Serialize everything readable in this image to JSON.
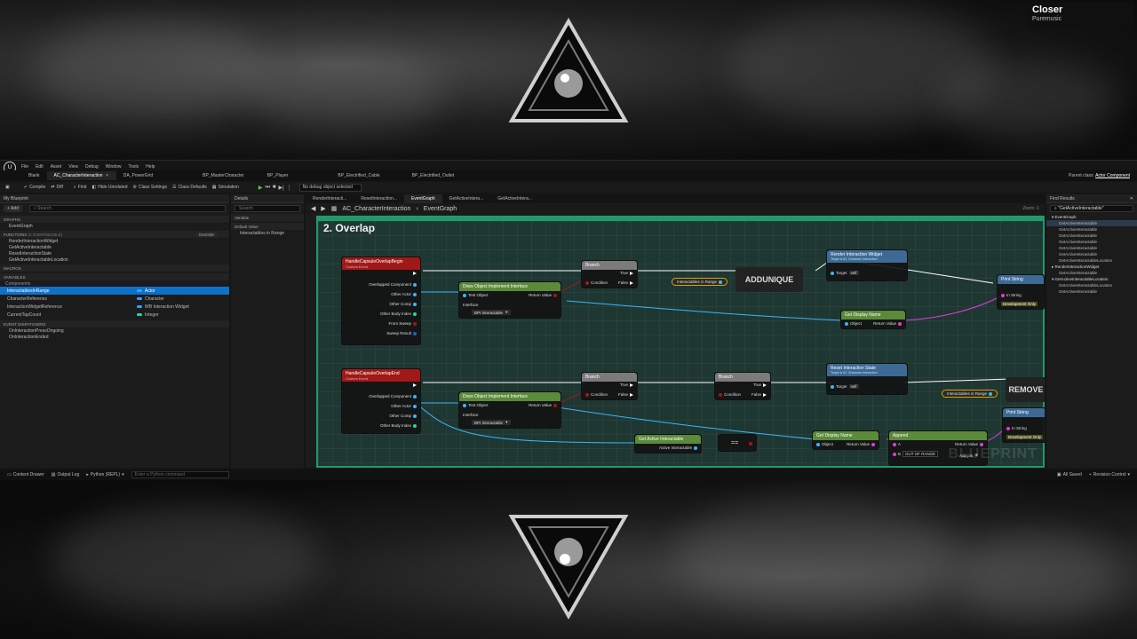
{
  "music": {
    "title": "Closer",
    "artist": "Puremusic"
  },
  "menu": [
    "File",
    "Edit",
    "Asset",
    "View",
    "Debug",
    "Window",
    "Tools",
    "Help"
  ],
  "doc_tabs": [
    {
      "label": "Blank"
    },
    {
      "label": "AC_CharacterInteraction",
      "active": true
    },
    {
      "label": "DA_PowerGrid"
    },
    {
      "label": "BP_MasterCharacter"
    },
    {
      "label": "BP_Player"
    },
    {
      "label": "BP_Electrified_Cable"
    },
    {
      "label": "BP_Electrified_Outlet"
    }
  ],
  "parent_class": {
    "label": "Parent class:",
    "value": "Actor Component"
  },
  "toolbar": {
    "compile": "Compile",
    "diff": "Diff",
    "find": "Find",
    "hide_unrelated": "Hide Unrelated",
    "class_settings": "Class Settings",
    "class_defaults": "Class Defaults",
    "simulation": "Simulation",
    "debug_select": "No debug object selected"
  },
  "my_blueprint": {
    "title": "My Blueprint",
    "add": "+ Add",
    "search_placeholder": "Search",
    "graphs_label": "GRAPHS",
    "graphs": [
      "EventGraph"
    ],
    "functions_label": "FUNCTIONS",
    "functions_count": "(2 OVERRIDABLE)",
    "override": "Override",
    "functions": [
      "RenderInteractionWidget",
      "GetActiveInteractable",
      "ResetInteractionState",
      "GetActiveInteractableLocation"
    ],
    "macros_label": "MACROS",
    "variables_label": "VARIABLES",
    "components_label": "Components",
    "variables": [
      {
        "name": "InteractablesInRange",
        "type": "Actor",
        "color": "#3aa0ff",
        "selected": true
      },
      {
        "name": "CharacterReference",
        "type": "Character",
        "color": "#3aa0ff"
      },
      {
        "name": "InteractionWidgetReference",
        "type": "WB Interaction Widget",
        "color": "#3aa0ff"
      },
      {
        "name": "CurrentTapCount",
        "type": "Integer",
        "color": "#1fd6b0"
      }
    ],
    "dispatchers_label": "EVENT DISPATCHERS",
    "dispatchers": [
      "OnInteractionPressOngoing",
      "OnInteractionEnded"
    ]
  },
  "details": {
    "title": "Details",
    "search_placeholder": "Search",
    "variable_label": "Variable",
    "default_value_label": "Default Value",
    "default_item": "Interactables in Range"
  },
  "graph": {
    "tabs": [
      "RenderInteracti...",
      "ResetInteraction...",
      "EventGraph",
      "GetActiveIntera...",
      "GetActiveIntera..."
    ],
    "breadcrumb_root": "AC_CharacterInteraction",
    "breadcrumb_leaf": "EventGraph",
    "zoom": "Zoom -1",
    "comment": "2. Overlap",
    "watermark": "BLUEPRINT",
    "nodes": {
      "begin_overlap": {
        "title": "HandleCapsuleOverlapBegin",
        "sub": "Custom Event",
        "pins": [
          "Overlapped Component",
          "Other Actor",
          "Other Comp",
          "Other Body Index",
          "From Sweep",
          "Sweep Result"
        ]
      },
      "end_overlap": {
        "title": "HandleCapsuleOverlapEnd",
        "sub": "Custom Event",
        "pins": [
          "Overlapped Component",
          "Other Actor",
          "Other Comp",
          "Other Body Index"
        ]
      },
      "implements_1": {
        "title": "Does Object Implement Interface",
        "test": "Test Object",
        "ret": "Return Value",
        "iface": "Interface",
        "iface_val": "BPI Interactable"
      },
      "implements_2": {
        "title": "Does Object Implement Interface",
        "test": "Test Object",
        "ret": "Return Value",
        "iface": "Interface",
        "iface_val": "BPI Interactable"
      },
      "branch_1": {
        "title": "Branch",
        "cond": "Condition",
        "t": "True",
        "f": "False"
      },
      "branch_2": {
        "title": "Branch",
        "cond": "Condition",
        "t": "True",
        "f": "False"
      },
      "branch_3": {
        "title": "Branch",
        "cond": "Condition",
        "t": "True",
        "f": "False"
      },
      "addunique": {
        "label": "ADDUNIQUE"
      },
      "remove": {
        "label": "REMOVE"
      },
      "getter_1": {
        "label": "Interactables in Range"
      },
      "getter_2": {
        "label": "Interactables in Range"
      },
      "render": {
        "title": "Render Interaction Widget",
        "sub": "Target is AC Character Interaction",
        "target": "Target",
        "self": "self"
      },
      "reset": {
        "title": "Reset Interaction State",
        "sub": "Target is AC Character Interaction",
        "target": "Target",
        "self": "self"
      },
      "display_1": {
        "title": "Get Display Name",
        "obj": "Object",
        "ret": "Return Value"
      },
      "display_2": {
        "title": "Get Display Name",
        "obj": "Object",
        "ret": "Return Value"
      },
      "print_1": {
        "title": "Print String",
        "in": "In String",
        "dev": "Development Only"
      },
      "print_2": {
        "title": "Print String",
        "in": "In String",
        "dev": "Development Only"
      },
      "append": {
        "title": "Append",
        "a": "A",
        "b": "B",
        "b_val": "OUT OF RANGE",
        "ret": "Return Value",
        "add_pin": "Add pin"
      },
      "get_active": {
        "title": "Get Active Interactable",
        "pin": "Active Interactable"
      }
    }
  },
  "find_results": {
    "title": "Find Results",
    "query": "\"GetActiveInteractable\"",
    "groups": [
      {
        "label": "EventGraph",
        "items": [
          "GetActiveInteractable",
          "GetActiveInteractable",
          "GetActiveInteractable",
          "GetActiveInteractable",
          "GetActiveInteractable",
          "GetActiveInteractable",
          "GetActiveInteractableLocation"
        ]
      },
      {
        "label": "RenderInteractionWidget",
        "items": [
          "GetActiveInteractable"
        ]
      },
      {
        "label": "GetActiveInteractableLocation",
        "items": [
          "GetActiveInteractableLocation",
          "GetActiveInteractable"
        ]
      }
    ]
  },
  "status": {
    "content_drawer": "Content Drawer",
    "output_log": "Output Log",
    "python": "Python (REPL)",
    "console_placeholder": "Enter a Python command",
    "all_saved": "All Saved",
    "revision": "Revision Control"
  }
}
